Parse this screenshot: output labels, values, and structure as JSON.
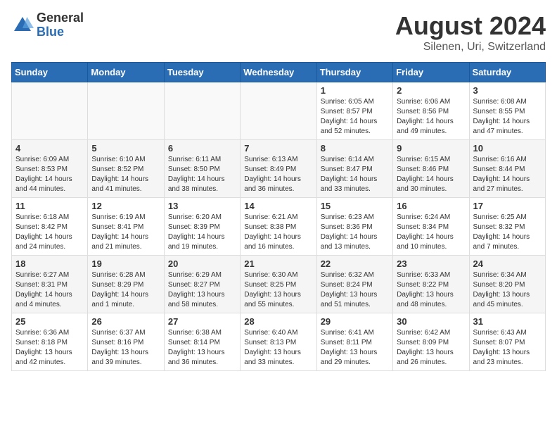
{
  "header": {
    "logo_general": "General",
    "logo_blue": "Blue",
    "main_title": "August 2024",
    "subtitle": "Silenen, Uri, Switzerland"
  },
  "days_of_week": [
    "Sunday",
    "Monday",
    "Tuesday",
    "Wednesday",
    "Thursday",
    "Friday",
    "Saturday"
  ],
  "weeks": [
    [
      {
        "day": "",
        "info": ""
      },
      {
        "day": "",
        "info": ""
      },
      {
        "day": "",
        "info": ""
      },
      {
        "day": "",
        "info": ""
      },
      {
        "day": "1",
        "info": "Sunrise: 6:05 AM\nSunset: 8:57 PM\nDaylight: 14 hours and 52 minutes."
      },
      {
        "day": "2",
        "info": "Sunrise: 6:06 AM\nSunset: 8:56 PM\nDaylight: 14 hours and 49 minutes."
      },
      {
        "day": "3",
        "info": "Sunrise: 6:08 AM\nSunset: 8:55 PM\nDaylight: 14 hours and 47 minutes."
      }
    ],
    [
      {
        "day": "4",
        "info": "Sunrise: 6:09 AM\nSunset: 8:53 PM\nDaylight: 14 hours and 44 minutes."
      },
      {
        "day": "5",
        "info": "Sunrise: 6:10 AM\nSunset: 8:52 PM\nDaylight: 14 hours and 41 minutes."
      },
      {
        "day": "6",
        "info": "Sunrise: 6:11 AM\nSunset: 8:50 PM\nDaylight: 14 hours and 38 minutes."
      },
      {
        "day": "7",
        "info": "Sunrise: 6:13 AM\nSunset: 8:49 PM\nDaylight: 14 hours and 36 minutes."
      },
      {
        "day": "8",
        "info": "Sunrise: 6:14 AM\nSunset: 8:47 PM\nDaylight: 14 hours and 33 minutes."
      },
      {
        "day": "9",
        "info": "Sunrise: 6:15 AM\nSunset: 8:46 PM\nDaylight: 14 hours and 30 minutes."
      },
      {
        "day": "10",
        "info": "Sunrise: 6:16 AM\nSunset: 8:44 PM\nDaylight: 14 hours and 27 minutes."
      }
    ],
    [
      {
        "day": "11",
        "info": "Sunrise: 6:18 AM\nSunset: 8:42 PM\nDaylight: 14 hours and 24 minutes."
      },
      {
        "day": "12",
        "info": "Sunrise: 6:19 AM\nSunset: 8:41 PM\nDaylight: 14 hours and 21 minutes."
      },
      {
        "day": "13",
        "info": "Sunrise: 6:20 AM\nSunset: 8:39 PM\nDaylight: 14 hours and 19 minutes."
      },
      {
        "day": "14",
        "info": "Sunrise: 6:21 AM\nSunset: 8:38 PM\nDaylight: 14 hours and 16 minutes."
      },
      {
        "day": "15",
        "info": "Sunrise: 6:23 AM\nSunset: 8:36 PM\nDaylight: 14 hours and 13 minutes."
      },
      {
        "day": "16",
        "info": "Sunrise: 6:24 AM\nSunset: 8:34 PM\nDaylight: 14 hours and 10 minutes."
      },
      {
        "day": "17",
        "info": "Sunrise: 6:25 AM\nSunset: 8:32 PM\nDaylight: 14 hours and 7 minutes."
      }
    ],
    [
      {
        "day": "18",
        "info": "Sunrise: 6:27 AM\nSunset: 8:31 PM\nDaylight: 14 hours and 4 minutes."
      },
      {
        "day": "19",
        "info": "Sunrise: 6:28 AM\nSunset: 8:29 PM\nDaylight: 14 hours and 1 minute."
      },
      {
        "day": "20",
        "info": "Sunrise: 6:29 AM\nSunset: 8:27 PM\nDaylight: 13 hours and 58 minutes."
      },
      {
        "day": "21",
        "info": "Sunrise: 6:30 AM\nSunset: 8:25 PM\nDaylight: 13 hours and 55 minutes."
      },
      {
        "day": "22",
        "info": "Sunrise: 6:32 AM\nSunset: 8:24 PM\nDaylight: 13 hours and 51 minutes."
      },
      {
        "day": "23",
        "info": "Sunrise: 6:33 AM\nSunset: 8:22 PM\nDaylight: 13 hours and 48 minutes."
      },
      {
        "day": "24",
        "info": "Sunrise: 6:34 AM\nSunset: 8:20 PM\nDaylight: 13 hours and 45 minutes."
      }
    ],
    [
      {
        "day": "25",
        "info": "Sunrise: 6:36 AM\nSunset: 8:18 PM\nDaylight: 13 hours and 42 minutes."
      },
      {
        "day": "26",
        "info": "Sunrise: 6:37 AM\nSunset: 8:16 PM\nDaylight: 13 hours and 39 minutes."
      },
      {
        "day": "27",
        "info": "Sunrise: 6:38 AM\nSunset: 8:14 PM\nDaylight: 13 hours and 36 minutes."
      },
      {
        "day": "28",
        "info": "Sunrise: 6:40 AM\nSunset: 8:13 PM\nDaylight: 13 hours and 33 minutes."
      },
      {
        "day": "29",
        "info": "Sunrise: 6:41 AM\nSunset: 8:11 PM\nDaylight: 13 hours and 29 minutes."
      },
      {
        "day": "30",
        "info": "Sunrise: 6:42 AM\nSunset: 8:09 PM\nDaylight: 13 hours and 26 minutes."
      },
      {
        "day": "31",
        "info": "Sunrise: 6:43 AM\nSunset: 8:07 PM\nDaylight: 13 hours and 23 minutes."
      }
    ]
  ]
}
